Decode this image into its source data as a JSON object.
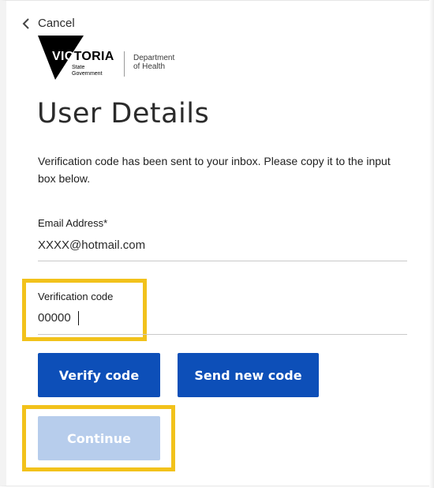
{
  "nav": {
    "cancel_label": "Cancel"
  },
  "logo": {
    "name_first": "VIC",
    "name_rest": "TORIA",
    "sub_line1": "State",
    "sub_line2": "Government",
    "dept_line1": "Department",
    "dept_line2": "of Health"
  },
  "page": {
    "title": "User Details",
    "instructions": "Verification code has been sent to your inbox. Please copy it to the input box below."
  },
  "form": {
    "email": {
      "label": "Email Address*",
      "value": "XXXX@hotmail.com"
    },
    "code": {
      "label": "Verification code",
      "value": "00000"
    }
  },
  "buttons": {
    "verify": "Verify code",
    "send_new": "Send new code",
    "continue": "Continue"
  },
  "colors": {
    "primary": "#0d4fb8",
    "disabled": "#b7cdec",
    "highlight": "#f2c21b"
  }
}
